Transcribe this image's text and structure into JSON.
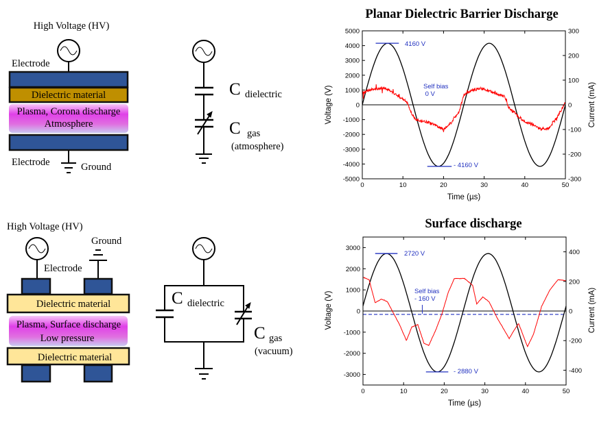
{
  "colors": {
    "electrode": "#2f5597",
    "dielectric_top": "#bf8f00",
    "dielectric_bottom": "#ffe699",
    "plasma": "#e040e8",
    "voltage_line": "#000000",
    "current_line": "#ff0000",
    "annotation": "#1f2fbf"
  },
  "top_diagram": {
    "hv_label": "High Voltage (HV)",
    "electrode_top_label": "Electrode",
    "dielectric_label": "Dielectric  material",
    "plasma_line1": "Plasma, Corona discharge",
    "plasma_line2": "Atmosphere",
    "electrode_bottom_label": "Electrode",
    "ground_label": "Ground",
    "icons": [
      "ac-source-icon",
      "ground-icon"
    ]
  },
  "top_circuit": {
    "c_dielectric": {
      "symbol": "C",
      "subscript": "dielectric"
    },
    "c_gas": {
      "symbol": "C",
      "subscript": "gas",
      "note": "(atmosphere)"
    },
    "icons": [
      "ac-source-icon",
      "capacitor-icon",
      "variable-capacitor-icon",
      "ground-icon"
    ]
  },
  "bottom_diagram": {
    "hv_label": "High  Voltage  (HV)",
    "ground_label": "Ground",
    "electrode_label": "Electrode",
    "dielectric_top_label": "Dielectric  material",
    "plasma_line1": "Plasma, Surface discharge",
    "plasma_line2": "Low pressure",
    "dielectric_bottom_label": "Dielectric  material",
    "icons": [
      "ac-source-icon",
      "ground-icon"
    ]
  },
  "bottom_circuit": {
    "c_dielectric": {
      "symbol": "C",
      "subscript": "dielectric"
    },
    "c_gas": {
      "symbol": "C",
      "subscript": "gas",
      "note": "(vacuum)"
    },
    "icons": [
      "ac-source-icon",
      "capacitor-icon",
      "variable-capacitor-icon",
      "ground-icon"
    ]
  },
  "chart_data": [
    {
      "type": "line",
      "title": "Planar Dielectric Barrier Discharge",
      "xlabel": "Time (µs)",
      "ylabel": "Voltage (V)",
      "y2label": "Current (mA)",
      "xlim": [
        0,
        50
      ],
      "ylim": [
        -5000,
        5000
      ],
      "y2lim": [
        -300,
        300
      ],
      "xticks": [
        0,
        10,
        20,
        30,
        40,
        50
      ],
      "yticks": [
        -5000,
        -4000,
        -3000,
        -2000,
        -1000,
        0,
        1000,
        2000,
        3000,
        4000,
        5000
      ],
      "y2ticks": [
        -300,
        -200,
        -100,
        0,
        100,
        200,
        300
      ],
      "grid": false,
      "zero_line": true,
      "series": [
        {
          "axis": "left",
          "color": "#000000",
          "x": [
            0,
            1.25,
            2.5,
            3.75,
            5,
            6.25,
            7.5,
            8.75,
            10,
            11.25,
            12.5,
            13.75,
            15,
            16.25,
            17.5,
            18.75,
            20,
            21.25,
            22.5,
            23.75,
            25,
            26.25,
            27.5,
            28.75,
            30,
            31.25,
            32.5,
            33.75,
            35,
            36.25,
            37.5,
            38.75,
            40,
            41.25,
            42.5,
            43.75,
            45,
            46.25,
            47.5,
            48.75,
            50
          ],
          "y": [
            0,
            1285,
            2445,
            3365,
            3956,
            4160,
            3956,
            3365,
            2445,
            1285,
            0,
            -1285,
            -2445,
            -3365,
            -3956,
            -4160,
            -3956,
            -3365,
            -2445,
            -1285,
            0,
            1285,
            2445,
            3365,
            3956,
            4160,
            3956,
            3365,
            2445,
            1285,
            0,
            -1285,
            -2445,
            -3365,
            -3956,
            -4160,
            -3956,
            -3365,
            -2445,
            -1285,
            0
          ]
        },
        {
          "axis": "right",
          "color": "#ff0000",
          "x": [
            0,
            2,
            5,
            7,
            9,
            11,
            12,
            13,
            16,
            19,
            20,
            22,
            24,
            25,
            27,
            30,
            33,
            35,
            36,
            38,
            40,
            42,
            44,
            46,
            48,
            50
          ],
          "y": [
            50,
            60,
            70,
            55,
            35,
            10,
            -30,
            -60,
            -70,
            -90,
            -100,
            -70,
            -20,
            40,
            60,
            65,
            45,
            35,
            -10,
            -40,
            -70,
            -80,
            -100,
            -95,
            -50,
            10
          ]
        }
      ],
      "annotations": [
        {
          "text": "4160 V",
          "voltage": 4160,
          "t_range": [
            3.3,
            9
          ]
        },
        {
          "text": "Self bias",
          "line2": " 0 V"
        },
        {
          "text": "- 4160 V",
          "voltage": -4160,
          "t_range": [
            16,
            22
          ]
        }
      ]
    },
    {
      "type": "line",
      "title": "Surface discharge",
      "xlabel": "Time (µs)",
      "ylabel": "Voltage (V)",
      "y2label": "Current (mA)",
      "xlim": [
        0,
        50
      ],
      "ylim": [
        -3500,
        3500
      ],
      "y2lim": [
        -500,
        500
      ],
      "xticks": [
        0,
        10,
        20,
        30,
        40,
        50
      ],
      "yticks": [
        -3000,
        -2000,
        -1000,
        0,
        1000,
        2000,
        3000
      ],
      "y2ticks": [
        -400,
        -200,
        0,
        200,
        400
      ],
      "grid": false,
      "zero_line": true,
      "self_bias_line": -160,
      "series": [
        {
          "axis": "left",
          "color": "#000000",
          "x": [
            0,
            1.25,
            2.5,
            3.75,
            5,
            6.25,
            7.5,
            8.75,
            10,
            11.25,
            12.5,
            13.75,
            15,
            16.25,
            17.5,
            18.75,
            20,
            21.25,
            22.5,
            23.75,
            25,
            26.25,
            27.5,
            28.75,
            30,
            31.25,
            32.5,
            33.75,
            35,
            36.25,
            37.5,
            38.75,
            40,
            41.25,
            42.5,
            43.75,
            45,
            46.25,
            47.5,
            48.75,
            50
          ],
          "y": [
            236,
            1082,
            1813,
            2356,
            2664,
            2703,
            2468,
            1984,
            1298,
            477,
            -396,
            -1242,
            -1973,
            -2516,
            -2824,
            -2863,
            -2628,
            -2144,
            -1458,
            -637,
            236,
            1082,
            1813,
            2356,
            2664,
            2703,
            2468,
            1984,
            1298,
            477,
            -396,
            -1242,
            -1973,
            -2516,
            -2824,
            -2863,
            -2628,
            -2144,
            -1458,
            -637,
            236
          ]
        },
        {
          "axis": "right",
          "color": "#ff0000",
          "x": [
            0,
            1.5,
            3,
            4.5,
            6,
            7.5,
            9,
            10.7,
            12,
            13.5,
            15,
            16.2,
            18,
            19.5,
            21,
            22.5,
            25,
            27,
            28,
            29.5,
            31,
            33,
            35,
            36,
            37,
            38.3,
            40.5,
            42,
            44,
            46,
            48,
            50
          ],
          "y": [
            228,
            212,
            56,
            80,
            64,
            -14,
            -92,
            -200,
            -108,
            -92,
            -217,
            -233,
            -123,
            -14,
            127,
            220,
            220,
            173,
            48,
            95,
            64,
            -45,
            -139,
            -186,
            -139,
            -84,
            -241,
            -155,
            33,
            142,
            212,
            205
          ]
        }
      ],
      "annotations": [
        {
          "text": "2720 V",
          "voltage": 2720,
          "t_range": [
            3,
            8.5
          ]
        },
        {
          "text": "Self bias",
          "line2": "- 160 V"
        },
        {
          "text": "- 2880 V",
          "voltage": -2880,
          "t_range": [
            15.5,
            21
          ]
        }
      ]
    }
  ]
}
